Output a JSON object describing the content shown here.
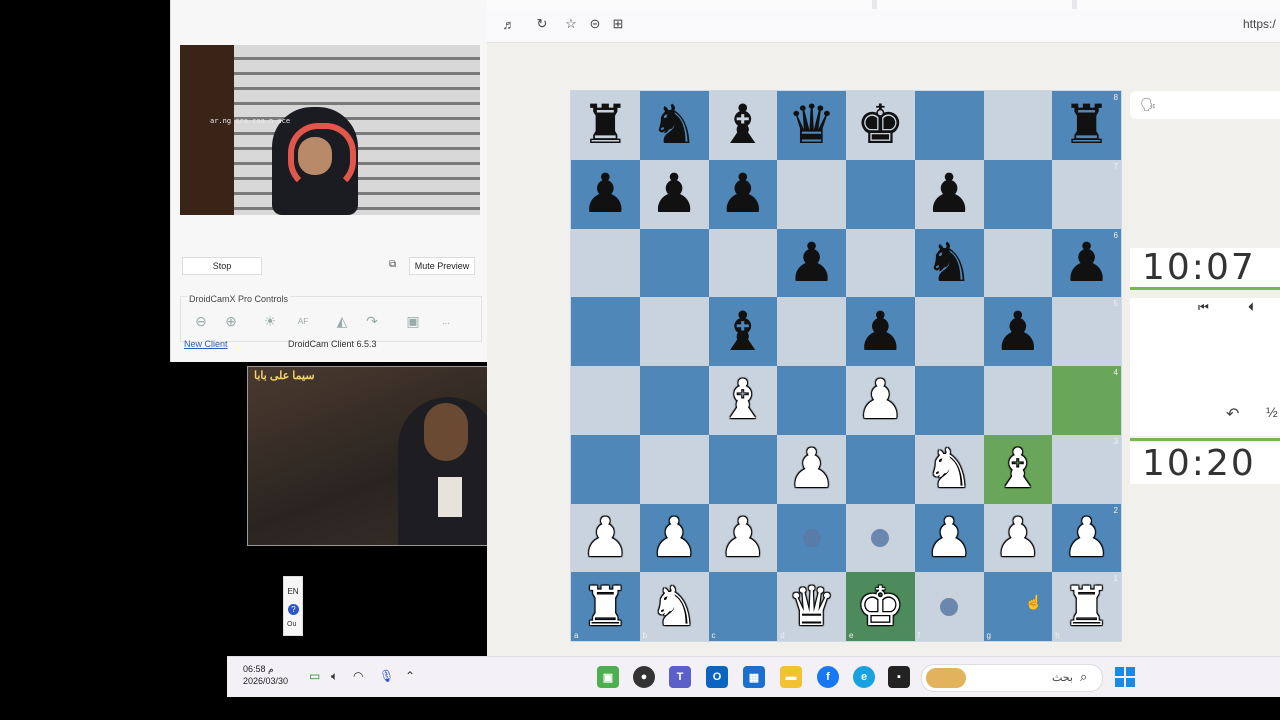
{
  "droidcam": {
    "overlay_text": "ar.ng cra.coa.n ace",
    "stop_label": "Stop",
    "mute_preview_label": "Mute Preview",
    "controls_title": "DroidCamX Pro Controls",
    "af_label": "AF",
    "more_label": "...",
    "new_client_label": "New Client",
    "version_label": "DroidCam Client 6.5.3"
  },
  "video": {
    "logo_text": "سيما على بابا"
  },
  "language": {
    "code": "EN",
    "help": "?",
    "extra": "Ou"
  },
  "browser": {
    "url_text": "https:/"
  },
  "board": {
    "colors": {
      "light": "#c9d3de",
      "dark": "#4f88b8",
      "highlight": "#6aa65a"
    },
    "ranks": [
      "8",
      "7",
      "6",
      "5",
      "4",
      "3",
      "2",
      "1"
    ],
    "files": [
      "a",
      "b",
      "c",
      "d",
      "e",
      "f",
      "g",
      "h"
    ],
    "position": [
      [
        "br",
        "bn",
        "bb",
        "bq",
        "bk",
        "",
        "",
        "br"
      ],
      [
        "bp",
        "bp",
        "bp",
        "",
        "",
        "bp",
        "",
        ""
      ],
      [
        "",
        "",
        "",
        "bp",
        "",
        "bn",
        "",
        "bp"
      ],
      [
        "",
        "",
        "bb",
        "",
        "bp",
        "",
        "bp",
        ""
      ],
      [
        "",
        "",
        "wb",
        "",
        "wp",
        "",
        "",
        ""
      ],
      [
        "",
        "",
        "",
        "wp",
        "",
        "wn",
        "wb",
        ""
      ],
      [
        "wp",
        "wp",
        "wp",
        "dot",
        "dot",
        "wp",
        "wp",
        "wp"
      ],
      [
        "wr",
        "wn",
        "",
        "wq",
        "wk",
        "dot",
        "",
        "wr"
      ]
    ],
    "highlights": [
      "h4",
      "g3",
      "e1"
    ]
  },
  "clocks": {
    "top": "10:07",
    "bottom": "10:20"
  },
  "controls": {
    "first_icon": "first-move-icon",
    "prev_icon": "prev-move-icon",
    "undo_icon": "undo-icon",
    "half_icon": "draw-offer-icon"
  },
  "taskbar": {
    "time": "06:58 م",
    "date": "2026/03/30",
    "search_placeholder": "بحث"
  }
}
